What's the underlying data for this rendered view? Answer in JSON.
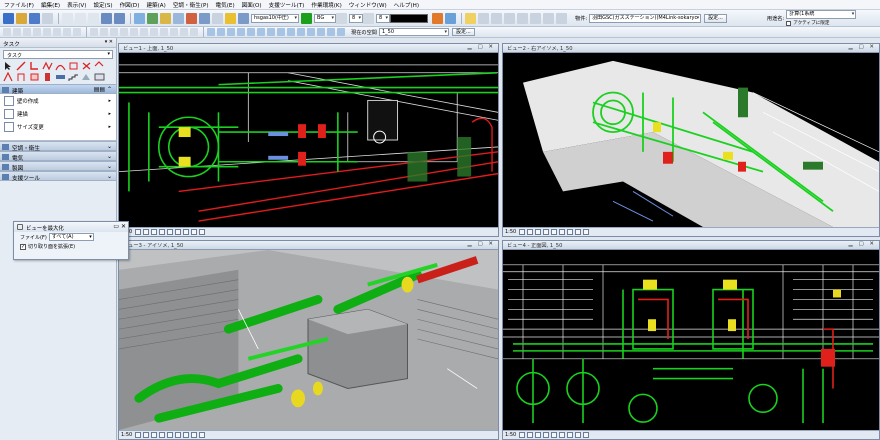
{
  "menu": [
    "ファイル(F)",
    "編集(E)",
    "表示(V)",
    "設定(S)",
    "作図(D)",
    "建築(A)",
    "空調・衛生(P)",
    "電気(E)",
    "図面(O)",
    "支援ツール(T)",
    "作業環境(K)",
    "ウィンドウ(W)",
    "ヘルプ(H)"
  ],
  "toolbar": {
    "layer_combo": "hsgas10(中圧)",
    "color_combo": "BG",
    "line_combo": "8",
    "weight_combo": "8",
    "property_label": "物件:",
    "property_value": "羽田GSC(ガスステーション)(M4Link-sokaryc",
    "settings_button": "設定...",
    "usage_label": "用途名:",
    "usage_value": "計算(1系統",
    "active_only_label": "アクティブに限定",
    "space_label": "現在の空間",
    "space_value": "1_50",
    "space_settings_button": "設定..."
  },
  "taskpane": {
    "title": "タスク",
    "selector": "タスク",
    "sections": [
      {
        "label": "建築",
        "active": true
      },
      {
        "label": "空調・衛生",
        "active": false
      },
      {
        "label": "電気",
        "active": false
      },
      {
        "label": "製図",
        "active": false
      },
      {
        "label": "支援ツール",
        "active": false
      }
    ],
    "tools": [
      "壁の作成",
      "建描",
      "サイズ変更"
    ]
  },
  "dialog": {
    "title": "ビューを最大化",
    "file_label": "ファイル(F)",
    "file_value": "すべて(A)",
    "checkbox_label": "切り取り面を拡張(E)",
    "checkbox_checked": true
  },
  "views": [
    {
      "title": "ビュー1 - 上面, 1_50",
      "scale": "1:50"
    },
    {
      "title": "ビュー2 - 右アイソメ, 1_50",
      "scale": "1:50"
    },
    {
      "title": "ビュー3 - アイソメ, 1_50",
      "scale": "1:50"
    },
    {
      "title": "ビュー4 - 正面図, 1_50",
      "scale": "1:50"
    }
  ],
  "colors": {
    "pipe_green": "#19d11e",
    "pipe_red": "#e0201a",
    "pipe_yellow": "#e9e020",
    "view_bg": "#000000",
    "chrome": "#dfe6ef"
  }
}
